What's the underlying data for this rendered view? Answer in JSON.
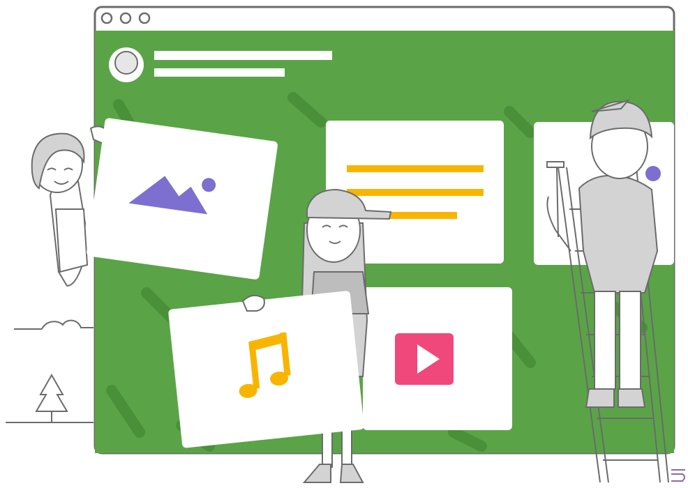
{
  "window": {
    "controls": [
      "close",
      "minimize",
      "maximize"
    ],
    "profile_icon": "avatar-icon"
  },
  "cards": [
    {
      "type": "image",
      "icon": "mountain-image-icon"
    },
    {
      "type": "text",
      "icon": "text-lines-icon"
    },
    {
      "type": "music",
      "icon": "music-note-icon"
    },
    {
      "type": "video",
      "icon": "play-icon"
    }
  ],
  "people": [
    "person-with-image",
    "person-with-cap",
    "person-on-ladder"
  ],
  "colors": {
    "green": "#5aa447",
    "green_dark": "#4a9038",
    "card": "#ffffff",
    "purple": "#7d6fd0",
    "yellow": "#f7b500",
    "pink": "#f0487a",
    "gray": "#d3d3d3",
    "outline": "#6b6b6b"
  }
}
